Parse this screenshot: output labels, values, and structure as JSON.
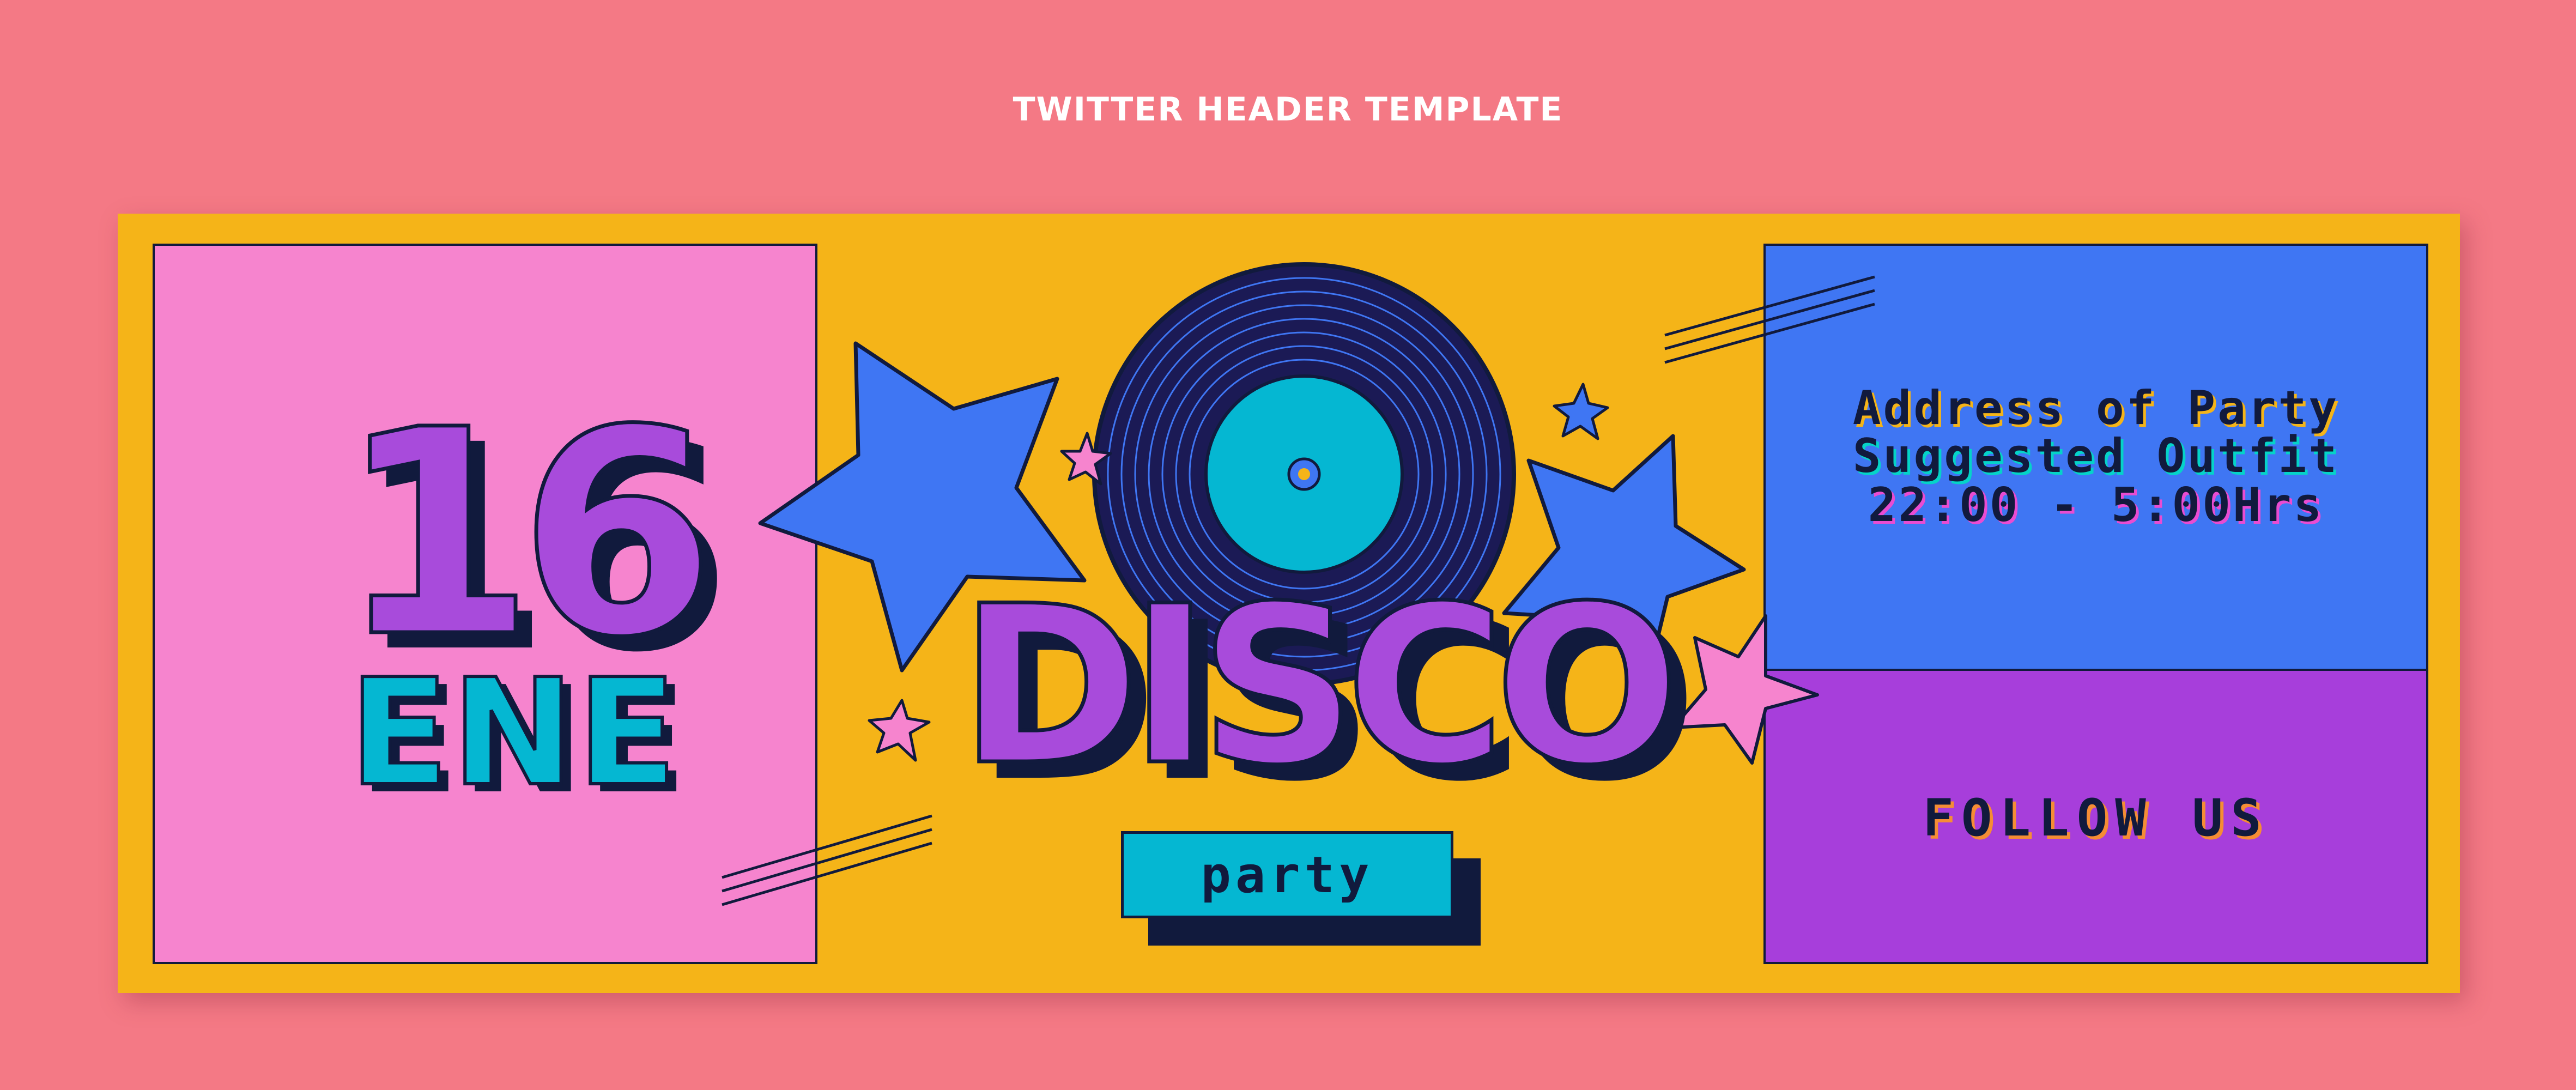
{
  "header": {
    "title": "TWITTER HEADER TEMPLATE"
  },
  "date": {
    "day": "16",
    "month": "ENE"
  },
  "event": {
    "title": "DISCO",
    "subtitle": "party"
  },
  "info": {
    "address": "Address of Party",
    "outfit": "Suggested Outfit",
    "hours": "22:00 - 5:00Hrs"
  },
  "follow": {
    "label": "FOLLOW US"
  },
  "colors": {
    "background": "#F47985",
    "banner": "#F5B418",
    "pink": "#F684CE",
    "blue": "#3F76F3",
    "purple": "#A84BDB",
    "cyan": "#05B7D2",
    "ink": "#111a3d"
  },
  "icons": [
    "vinyl-record-icon",
    "star-icon",
    "speed-lines-icon"
  ]
}
